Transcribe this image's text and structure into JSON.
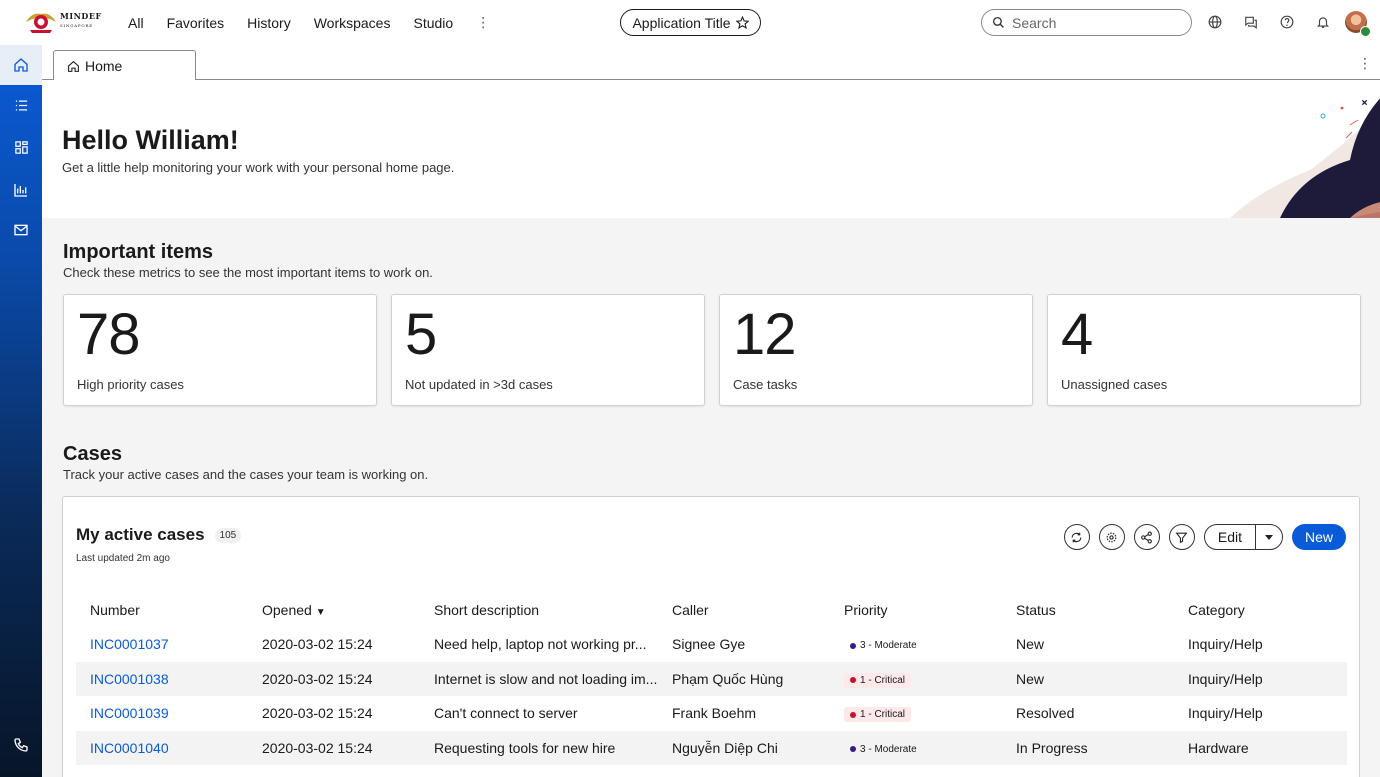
{
  "header": {
    "logo_main": "MINDEF",
    "logo_sub": "SINGAPORE",
    "nav": [
      "All",
      "Favorites",
      "History",
      "Workspaces",
      "Studio"
    ],
    "app_title": "Application Title",
    "search_placeholder": "Search"
  },
  "tabs": [
    {
      "label": "Home"
    }
  ],
  "hero": {
    "greeting": "Hello William!",
    "subtitle": "Get a little help monitoring your work with your personal home page.",
    "close_label": "Close"
  },
  "important": {
    "title": "Important items",
    "subtitle": "Check these metrics to see the most important items to work on.",
    "cards": [
      {
        "value": "78",
        "label": "High priority cases"
      },
      {
        "value": "5",
        "label": "Not updated in >3d cases"
      },
      {
        "value": "12",
        "label": "Case tasks"
      },
      {
        "value": "4",
        "label": "Unassigned cases"
      }
    ]
  },
  "cases": {
    "title": "Cases",
    "subtitle": "Track your active cases and the cases your team is working on.",
    "panel_title": "My active cases",
    "count": "105",
    "updated": "Last updated 2m ago",
    "edit_label": "Edit",
    "new_label": "New",
    "columns": [
      "Number",
      "Opened",
      "Short description",
      "Caller",
      "Priority",
      "Status",
      "Category"
    ],
    "rows": [
      {
        "number": "INC0001037",
        "opened": "2020-03-02 15:24",
        "desc": "Need help, laptop not working pr...",
        "caller": "Signee Gye",
        "priority": "3 - Moderate",
        "status": "New",
        "category": "Inquiry/Help"
      },
      {
        "number": "INC0001038",
        "opened": "2020-03-02 15:24",
        "desc": "Internet is slow and not loading im...",
        "caller": "Phạm Quốc Hùng",
        "priority": "1 - Critical",
        "status": "New",
        "category": "Inquiry/Help"
      },
      {
        "number": "INC0001039",
        "opened": "2020-03-02 15:24",
        "desc": "Can't connect to server",
        "caller": "Frank Boehm",
        "priority": "1 - Critical",
        "status": "Resolved",
        "category": "Inquiry/Help"
      },
      {
        "number": "INC0001040",
        "opened": "2020-03-02 15:24",
        "desc": "Requesting tools for new hire",
        "caller": "Nguyễn Diệp Chi",
        "priority": "3 - Moderate",
        "status": "In Progress",
        "category": "Hardware"
      }
    ]
  },
  "colors": {
    "accent": "#0a5bd8",
    "critical": "#c8102e",
    "moderate": "#3a1a8a"
  }
}
